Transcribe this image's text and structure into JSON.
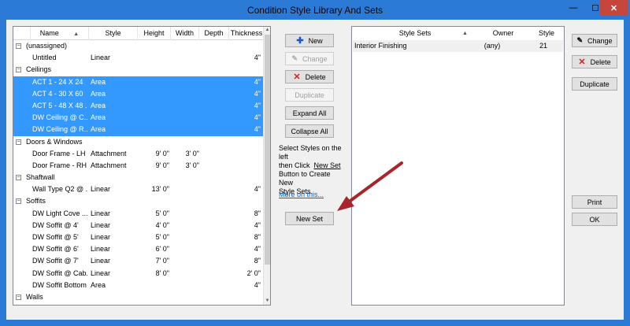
{
  "window": {
    "title": "Condition Style Library And Sets",
    "min_label": "—",
    "max_label": "☐",
    "close_label": "✕"
  },
  "left_table": {
    "columns": {
      "name": "Name",
      "style": "Style",
      "height": "Height",
      "width": "Width",
      "depth": "Depth",
      "thickness": "Thickness"
    },
    "sort_indicator": "▲",
    "rows": [
      {
        "kind": "group",
        "label": "(unassigned)"
      },
      {
        "kind": "item",
        "name": "Untitled",
        "style": "Linear",
        "height": "",
        "width": "",
        "thickness": "4\"",
        "selected": false
      },
      {
        "kind": "group",
        "label": "Ceilings"
      },
      {
        "kind": "item",
        "name": "ACT 1 - 24 X 24",
        "style": "Area",
        "height": "",
        "width": "",
        "thickness": "4\"",
        "selected": true
      },
      {
        "kind": "item",
        "name": "ACT 4 - 30 X 60",
        "style": "Area",
        "height": "",
        "width": "",
        "thickness": "4\"",
        "selected": true
      },
      {
        "kind": "item",
        "name": "ACT 5 - 48 X 48 ...",
        "style": "Area",
        "height": "",
        "width": "",
        "thickness": "4\"",
        "selected": true
      },
      {
        "kind": "item",
        "name": "DW Ceiling @ C...",
        "style": "Area",
        "height": "",
        "width": "",
        "thickness": "4\"",
        "selected": true
      },
      {
        "kind": "item",
        "name": "DW Ceiling @ R...",
        "style": "Area",
        "height": "",
        "width": "",
        "thickness": "4\"",
        "selected": true
      },
      {
        "kind": "group",
        "label": "Doors & Windows"
      },
      {
        "kind": "item",
        "name": "Door Frame - LH",
        "style": "Attachment",
        "height": "9' 0\"",
        "width": "3' 0\"",
        "thickness": "",
        "selected": false
      },
      {
        "kind": "item",
        "name": "Door Frame - RH",
        "style": "Attachment",
        "height": "9' 0\"",
        "width": "3' 0\"",
        "thickness": "",
        "selected": false
      },
      {
        "kind": "group",
        "label": "Shaftwall"
      },
      {
        "kind": "item",
        "name": "Wall Type Q2 @ ...",
        "style": "Linear",
        "height": "13' 0\"",
        "width": "",
        "thickness": "4\"",
        "selected": false
      },
      {
        "kind": "group",
        "label": "Soffits"
      },
      {
        "kind": "item",
        "name": "DW Light Cove ...",
        "style": "Linear",
        "height": "5' 0\"",
        "width": "",
        "thickness": "8\"",
        "selected": false
      },
      {
        "kind": "item",
        "name": "DW Soffit @ 4'",
        "style": "Linear",
        "height": "4' 0\"",
        "width": "",
        "thickness": "4\"",
        "selected": false
      },
      {
        "kind": "item",
        "name": "DW Soffit @ 5'",
        "style": "Linear",
        "height": "5' 0\"",
        "width": "",
        "thickness": "8\"",
        "selected": false
      },
      {
        "kind": "item",
        "name": "DW Soffit @ 6'",
        "style": "Linear",
        "height": "6' 0\"",
        "width": "",
        "thickness": "4\"",
        "selected": false
      },
      {
        "kind": "item",
        "name": "DW Soffit @ 7'",
        "style": "Linear",
        "height": "7' 0\"",
        "width": "",
        "thickness": "8\"",
        "selected": false
      },
      {
        "kind": "item",
        "name": "DW Soffit @ Cab...",
        "style": "Linear",
        "height": "8' 0\"",
        "width": "",
        "thickness": "2' 0\"",
        "selected": false
      },
      {
        "kind": "item",
        "name": "DW Soffit Bottom",
        "style": "Area",
        "height": "",
        "width": "",
        "thickness": "4\"",
        "selected": false
      },
      {
        "kind": "group",
        "label": "Walls"
      }
    ]
  },
  "middle": {
    "new_label": "New",
    "change_label": "Change",
    "delete_label": "Delete",
    "duplicate_label": "Duplicate",
    "expand_label": "Expand All",
    "collapse_label": "Collapse All",
    "info_line1": "Select Styles on the left",
    "info_line2a": "then Click  ",
    "info_line2b": "New Set",
    "info_line3": "Button to Create New",
    "info_line4": "Style Sets.",
    "more_link": "More on this...",
    "new_set_label": "New Set"
  },
  "right_table": {
    "columns": {
      "style_sets": "Style Sets",
      "owner": "Owner",
      "style": "Style"
    },
    "sort_indicator": "▲",
    "rows": [
      {
        "name": "Interior Finishing",
        "owner": "(any)",
        "style": "21"
      }
    ]
  },
  "right_buttons": {
    "change_label": "Change",
    "delete_label": "Delete",
    "duplicate_label": "Duplicate",
    "print_label": "Print",
    "ok_label": "OK"
  },
  "colors": {
    "selection": "#3399ff",
    "titlebar": "#2b7bd6",
    "close": "#c7463b",
    "arrow": "#a8252c"
  }
}
